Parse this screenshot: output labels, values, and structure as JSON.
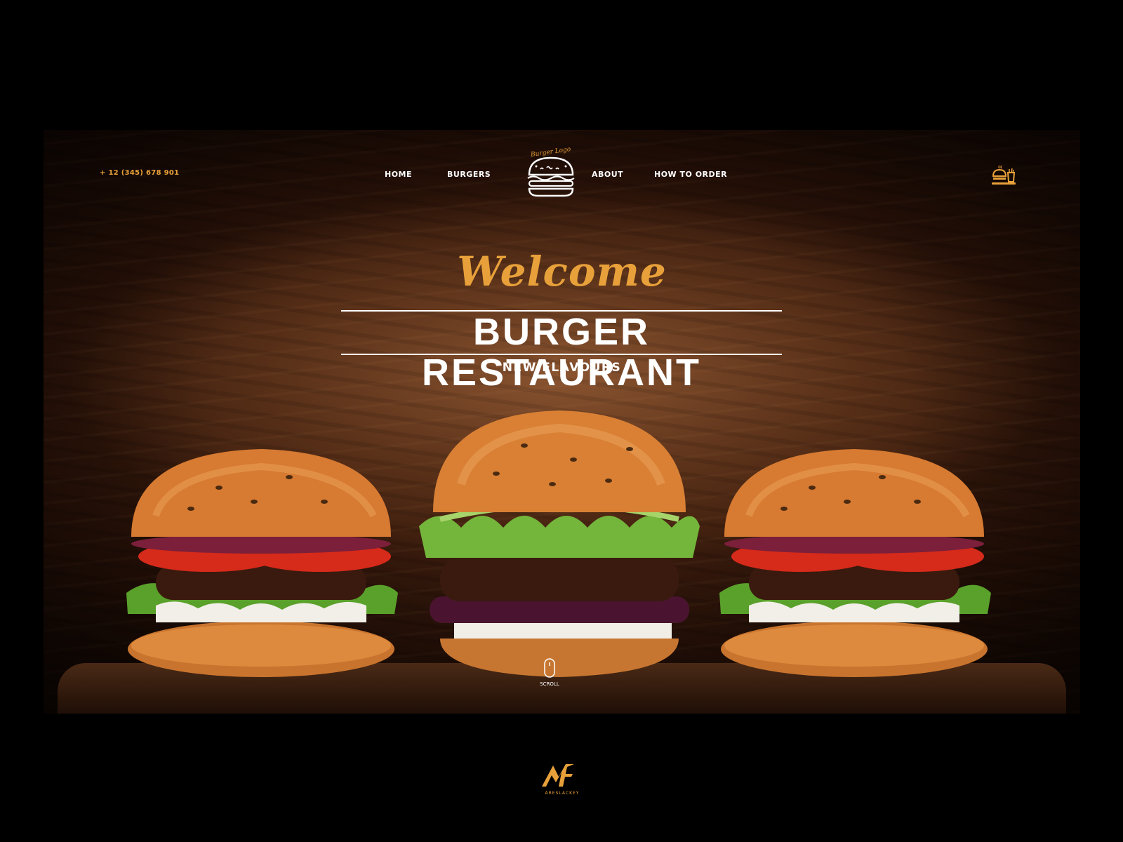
{
  "header": {
    "phone": "+ 12 (345) 678 901",
    "nav": [
      "HOME",
      "BURGERS",
      "ABOUT",
      "HOW TO ORDER"
    ],
    "logo_text": "Burger Logo"
  },
  "hero": {
    "welcome": "Welcome",
    "title": "BURGER RESTAURANT",
    "subtitle": "NEW FLAVOURS",
    "scroll_label": "SCROLL"
  },
  "icons": {
    "logo": "burger-logo-icon",
    "cart": "food-tray-icon",
    "scroll": "mouse-scroll-icon",
    "brand": "af-monogram-icon"
  },
  "brand": {
    "caption": "ARESLACKEY"
  },
  "colors": {
    "accent": "#e8a13a",
    "text": "#ffffff",
    "page_bg": "#000000",
    "hero_bg": "#4a2511"
  }
}
